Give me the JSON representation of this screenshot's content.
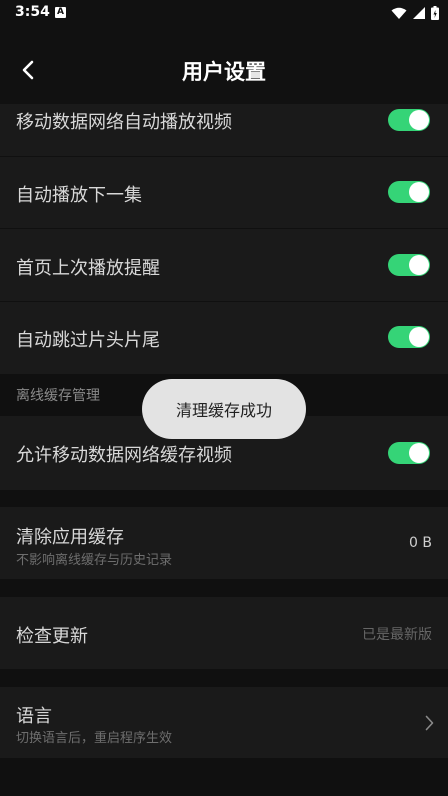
{
  "status_bar": {
    "time": "3:54",
    "notification_letter": "A"
  },
  "header": {
    "title": "用户设置"
  },
  "settings": {
    "mobile_autoplay": {
      "label": "移动数据网络自动播放视频",
      "enabled": true
    },
    "autoplay_next": {
      "label": "自动播放下一集",
      "enabled": true
    },
    "last_play_reminder": {
      "label": "首页上次播放提醒",
      "enabled": true
    },
    "skip_intro_outro": {
      "label": "自动跳过片头片尾",
      "enabled": true
    }
  },
  "offline_section": {
    "title": "离线缓存管理",
    "allow_mobile_cache": {
      "label": "允许移动数据网络缓存视频",
      "enabled": true
    }
  },
  "clear_cache": {
    "label": "清除应用缓存",
    "sublabel": "不影响离线缓存与历史记录",
    "value": "0 B"
  },
  "check_update": {
    "label": "检查更新",
    "value": "已是最新版"
  },
  "language": {
    "label": "语言",
    "sublabel": "切换语言后，重启程序生效"
  },
  "toast": {
    "message": "清理缓存成功"
  },
  "colors": {
    "accent": "#35d477",
    "background": "#101010",
    "row": "#1a1a1a"
  }
}
